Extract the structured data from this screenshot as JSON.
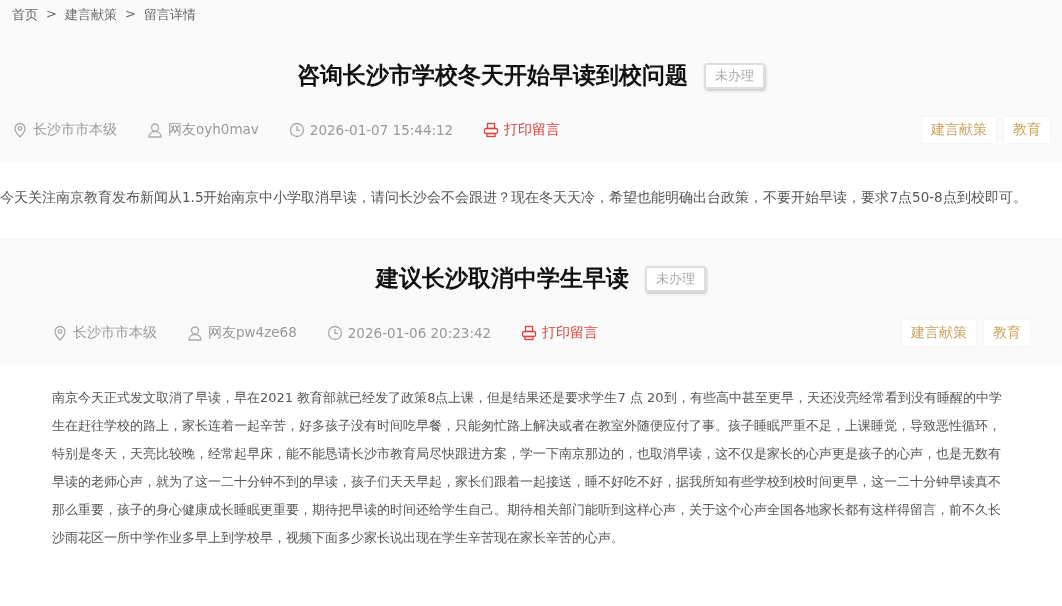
{
  "breadcrumb": [
    "首页",
    ">",
    "建言献策",
    ">",
    "留言详情"
  ],
  "posts": [
    {
      "title": "咨询长沙市学校冬天开始早读到校问题",
      "status": "未办理",
      "location": "长沙市市本级",
      "author": "网友oyh0mav",
      "time": "2026-01-07 15:44:12",
      "print": "打印留言",
      "tags": [
        "建言献策",
        "教育"
      ],
      "body": "今天关注南京教育发布新闻从1.5开始南京中小学取消早读，请问长沙会不会跟进？现在冬天天冷，希望也能明确出台政策，不要开始早读，要求7点50-8点到校即可。"
    },
    {
      "title": "建议长沙取消中学生早读",
      "status": "未办理",
      "location": "长沙市市本级",
      "author": "网友pw4ze68",
      "time": "2026-01-06 20:23:42",
      "print": "打印留言",
      "tags": [
        "建言献策",
        "教育"
      ],
      "body": "南京今天正式发文取消了早读，早在2021 教育部就已经发了政策8点上课，但是结果还是要求学生7 点 20到，有些高中甚至更早，天还没亮经常看到没有睡醒的中学生在赶往学校的路上，家长连着一起辛苦，好多孩子没有时间吃早餐，只能匆忙路上解决或者在教室外随便应付了事。孩子睡眠严重不足，上课睡觉，导致恶性循环，特别是冬天，天亮比较晚，经常起早床，能不能恳请长沙市教育局尽快跟进方案，学一下南京那边的，也取消早读，这不仅是家长的心声更是孩子的心声，也是无数有早读的老师心声，就为了这一二十分钟不到的早读，孩子们天天早起，家长们跟着一起接送，睡不好吃不好，据我所知有些学校到校时间更早，这一二十分钟早读真不那么重要，孩子的身心健康成长睡眠更重要，期待把早读的时间还给学生自己。期待相关部门能听到这样心声，关于这个心声全国各地家长都有这样得留言，前不久长沙雨花区一所中学作业多早上到学校早，视频下面多少家长说出现在学生辛苦现在家长辛苦的心声。"
    }
  ]
}
